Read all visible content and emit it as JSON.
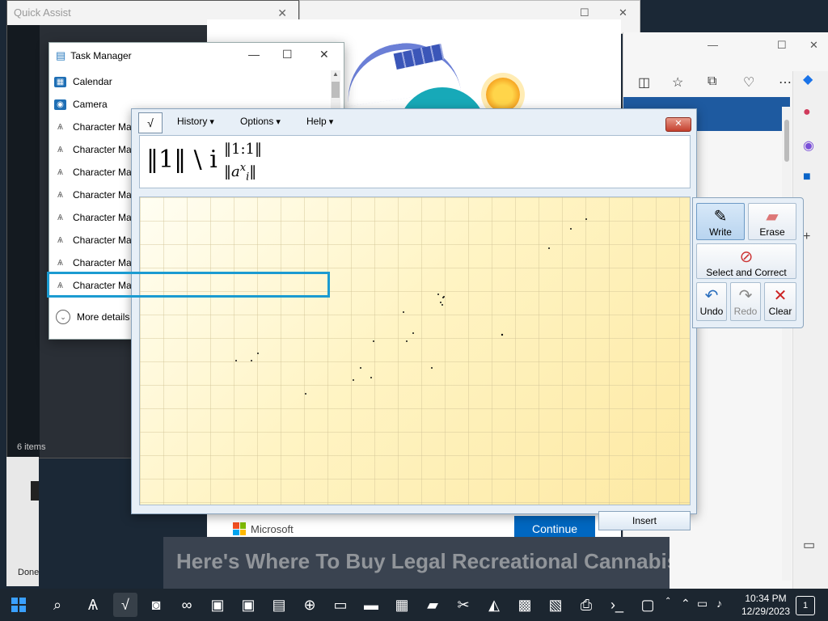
{
  "quick_assist": {
    "title": "Quick Assist",
    "status": "6 items",
    "status2": "Done"
  },
  "task_manager": {
    "title": "Task Manager",
    "items": [
      {
        "name": "Calendar",
        "icon": "calendar-icon"
      },
      {
        "name": "Camera",
        "icon": "camera-icon"
      },
      {
        "name": "Character Map",
        "icon": "character-map-icon"
      },
      {
        "name": "Character Map",
        "icon": "character-map-icon"
      },
      {
        "name": "Character Map",
        "icon": "character-map-icon"
      },
      {
        "name": "Character Map",
        "icon": "character-map-icon"
      },
      {
        "name": "Character Map",
        "icon": "character-map-icon"
      },
      {
        "name": "Character Map",
        "icon": "character-map-icon"
      },
      {
        "name": "Character Map",
        "icon": "character-map-icon"
      },
      {
        "name": "Character Map",
        "icon": "character-map-icon"
      }
    ],
    "more_details": "More details"
  },
  "math_panel": {
    "menus": [
      "History",
      "Options",
      "Help"
    ],
    "expression": {
      "main": "‖1‖ \\ i",
      "sup": "‖1:1‖",
      "sub": "‖a",
      "sub_x": "x",
      "sub_i": "i",
      "sub_end": "‖"
    },
    "tools": {
      "write": "Write",
      "erase": "Erase",
      "select_correct": "Select and Correct",
      "undo": "Undo",
      "redo": "Redo",
      "clear": "Clear"
    },
    "insert": "Insert",
    "accent_color": "#1b9bd1"
  },
  "background_page": {
    "brand": "Microsoft",
    "continue": "Continue",
    "headline": "Here's Where To Buy Legal Recreational Cannabis Store Openings Ahead Of The New Year"
  },
  "taskbar": {
    "time": "10:34 PM",
    "date": "12/29/2023",
    "notifications": "1"
  }
}
